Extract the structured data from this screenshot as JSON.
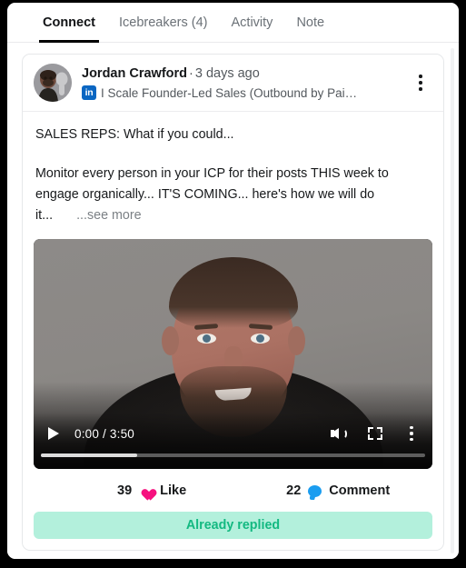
{
  "tabs": [
    {
      "label": "Connect",
      "active": true
    },
    {
      "label": "Icebreakers (4)",
      "active": false
    },
    {
      "label": "Activity",
      "active": false
    },
    {
      "label": "Note",
      "active": false
    }
  ],
  "post": {
    "author_name": "Jordan Crawford",
    "separator": "·",
    "time_ago": "3 days ago",
    "network_badge": "in",
    "headline": "I Scale Founder-Led Sales (Outbound by Pai…",
    "menu_icon": "kebab-menu-icon",
    "body_line_1": "SALES REPS: What if you could...",
    "body_line_2": "Monitor every person in your ICP for their posts THIS week to engage organically... IT'S COMING... here's how we will do it...",
    "see_more": "...see more"
  },
  "video": {
    "play_icon": "play-icon",
    "time_display": "0:00 / 3:50",
    "volume_icon": "volume-icon",
    "fullscreen_icon": "fullscreen-icon",
    "menu_icon": "kebab-menu-icon",
    "progress_percent": 25
  },
  "reactions": {
    "like_count": "39",
    "like_label": "Like",
    "like_icon": "heart-icon",
    "comment_count": "22",
    "comment_label": "Comment",
    "comment_icon": "speech-bubble-icon"
  },
  "status": {
    "label": "Already replied"
  },
  "colors": {
    "heart": "#f6117f",
    "bubble": "#1b9df0",
    "linkedin": "#0a66c2",
    "banner_bg": "#b3f0dc",
    "banner_text": "#13b981",
    "active_tab_underline": "#000000"
  }
}
